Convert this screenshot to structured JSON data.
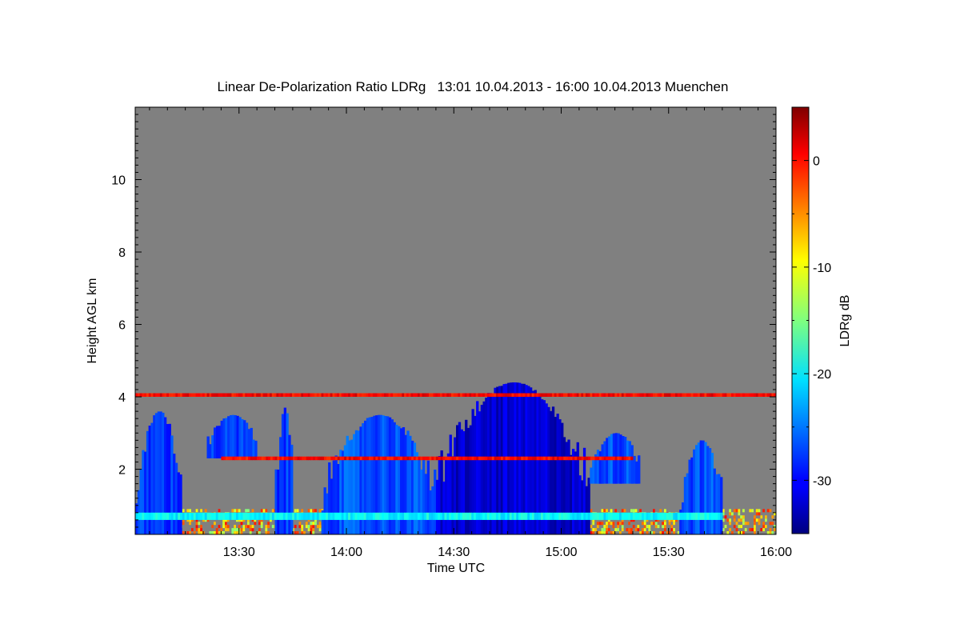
{
  "chart_data": {
    "type": "heatmap",
    "title": "Linear De-Polarization Ratio LDRg   13:01 10.04.2013 - 16:00 10.04.2013 Muenchen",
    "xlabel": "Time UTC",
    "ylabel": "Height AGL km",
    "colorbar_label": "LDRg dB",
    "x_ticks": [
      "13:30",
      "14:00",
      "14:30",
      "15:00",
      "15:30",
      "16:00"
    ],
    "x_tick_values_min": [
      810,
      840,
      870,
      900,
      930,
      960
    ],
    "xlim_min": [
      781,
      960
    ],
    "y_ticks": [
      2,
      4,
      6,
      8,
      10
    ],
    "ylim": [
      0.2,
      12.0
    ],
    "colorbar_ticks": [
      0,
      -10,
      -20,
      -30
    ],
    "colorbar_range": [
      -35,
      5
    ],
    "background_color": "#808080",
    "colormap": "jet",
    "features": [
      {
        "name": "low-level noisy layer",
        "time_range": [
          "13:01",
          "16:00"
        ],
        "height_km": [
          0.2,
          0.9
        ],
        "ldr_db": [
          -15,
          0
        ]
      },
      {
        "name": "cloud 1",
        "time_range": [
          "13:01",
          "13:14"
        ],
        "height_km": [
          0.2,
          3.6
        ],
        "ldr_db": -28
      },
      {
        "name": "cloud 2",
        "time_range": [
          "13:21",
          "13:35"
        ],
        "height_km": [
          2.3,
          3.5
        ],
        "ldr_db": -28
      },
      {
        "name": "cloud 3",
        "time_range": [
          "13:40",
          "13:45"
        ],
        "height_km": [
          0.2,
          3.7
        ],
        "ldr_db": -28
      },
      {
        "name": "cloud 4",
        "time_range": [
          "13:53",
          "14:25"
        ],
        "height_km": [
          0.2,
          3.5
        ],
        "ldr_db": -27
      },
      {
        "name": "main cloud",
        "time_range": [
          "14:25",
          "15:08"
        ],
        "height_km": [
          0.2,
          4.4
        ],
        "ldr_db": -32
      },
      {
        "name": "cloud 5",
        "time_range": [
          "15:08",
          "15:22"
        ],
        "height_km": [
          1.6,
          3.0
        ],
        "ldr_db": -27
      },
      {
        "name": "cloud 6",
        "time_range": [
          "15:33",
          "15:45"
        ],
        "height_km": [
          0.2,
          2.8
        ],
        "ldr_db": -27
      },
      {
        "name": "melting layer",
        "time_range": [
          "13:01",
          "15:45"
        ],
        "height_km": [
          0.6,
          0.8
        ],
        "ldr_db": -20
      },
      {
        "name": "noise line 4 km",
        "time_range": [
          "13:01",
          "16:00"
        ],
        "height_km": [
          4.0,
          4.1
        ],
        "ldr_db": 0
      },
      {
        "name": "noise line 2.3 km",
        "time_range": [
          "13:25",
          "15:20"
        ],
        "height_km": [
          2.25,
          2.35
        ],
        "ldr_db": 0
      }
    ]
  }
}
